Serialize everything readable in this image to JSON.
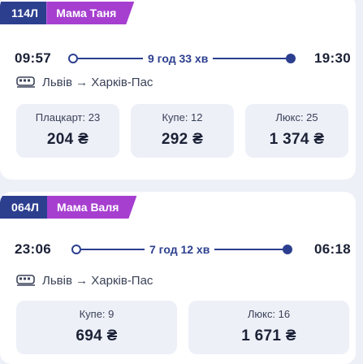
{
  "trains": [
    {
      "number": "114Л",
      "name": "Мама Таня",
      "departure": "09:57",
      "duration": "9 год 33 хв",
      "arrival": "19:30",
      "route": "Львів → Харків-Пас",
      "fares": [
        {
          "label": "Плацкарт: 23",
          "price": "204 ₴"
        },
        {
          "label": "Купе: 12",
          "price": "292 ₴"
        },
        {
          "label": "Люкс: 25",
          "price": "1 374 ₴"
        }
      ]
    },
    {
      "number": "064Л",
      "name": "Мама Валя",
      "departure": "23:06",
      "duration": "7 год 12 хв",
      "arrival": "06:18",
      "route": "Львів → Харків-Пас",
      "fares": [
        {
          "label": "Купе: 9",
          "price": "694 ₴"
        },
        {
          "label": "Люкс: 16",
          "price": "1 671 ₴"
        }
      ]
    }
  ],
  "colors": {
    "accent": "#2c3f8f",
    "name_tag": "#a63fd0",
    "background": "#eef0f8",
    "fare_box": "#eef0f8"
  },
  "icons": {
    "train": "train-icon",
    "arrow": "arrow-right"
  }
}
